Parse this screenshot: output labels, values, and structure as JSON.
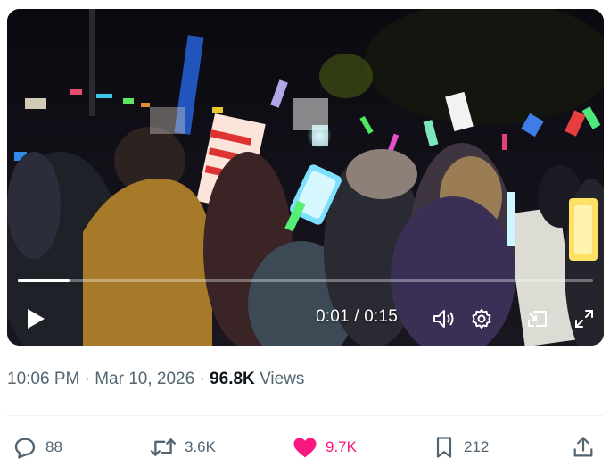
{
  "video": {
    "progress_fraction": 0.09,
    "time_current": "0:01",
    "time_separator": "/",
    "time_total": "0:15"
  },
  "post_meta": {
    "time": "10:06 PM",
    "dot1": "·",
    "date": "Mar 10, 2026",
    "dot2": "·",
    "views_count": "96.8K",
    "views_label": "Views"
  },
  "actions": {
    "replies": "88",
    "reposts": "3.6K",
    "likes": "9.7K",
    "bookmarks": "212"
  },
  "colors": {
    "like_active": "#f91880",
    "icon_gray": "#536471",
    "text_primary": "#0f1419"
  }
}
